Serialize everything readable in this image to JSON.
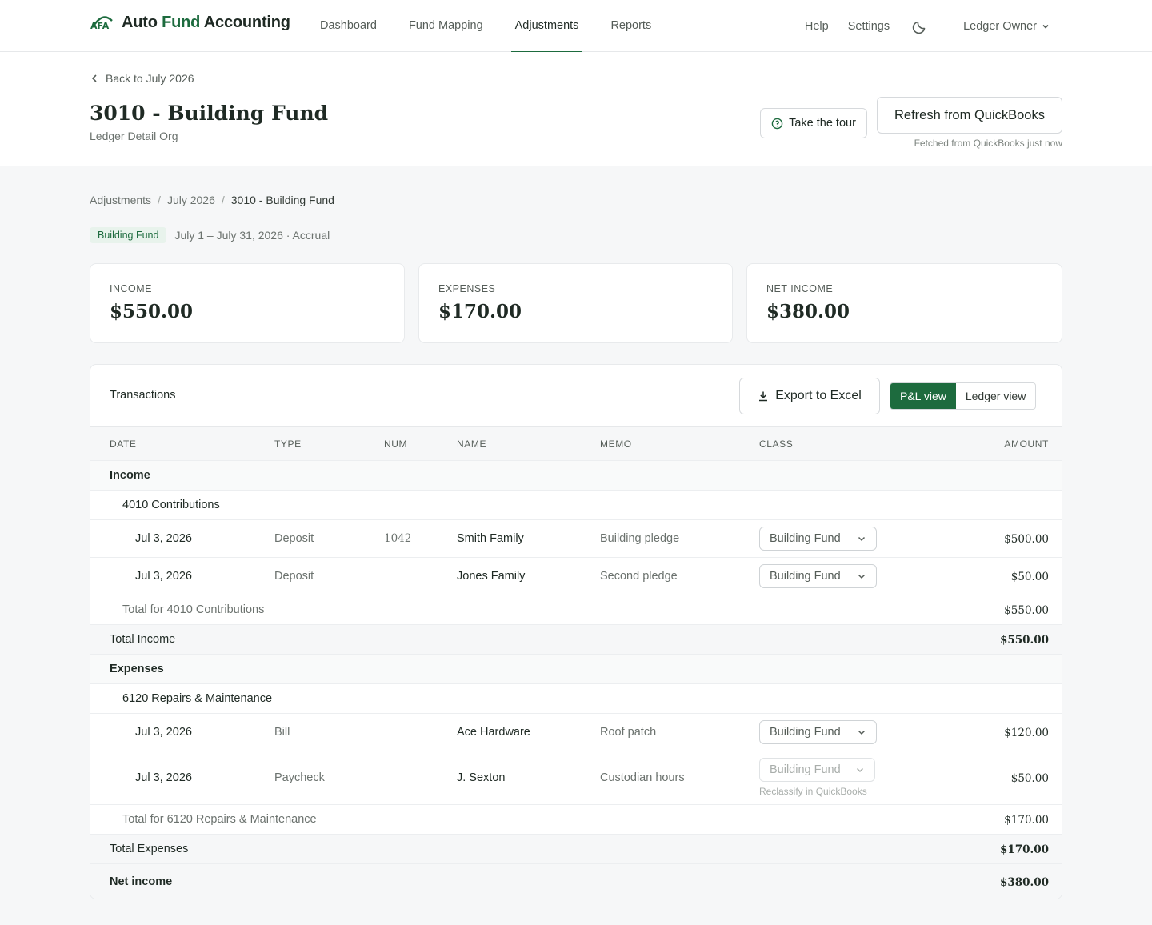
{
  "nav": {
    "brand_part1": "Auto ",
    "brand_part2": "Fund",
    "brand_part3": " Accounting",
    "logo_mark": "AFA",
    "links": [
      "Dashboard",
      "Fund Mapping",
      "Adjustments",
      "Reports"
    ],
    "active_link": "Adjustments",
    "help": "Help",
    "settings": "Settings",
    "user": "Ledger Owner"
  },
  "header": {
    "back": "Back to July 2026",
    "title": "3010 - Building Fund",
    "subtitle": "Ledger Detail Org",
    "tour": "Take the tour",
    "refresh": "Refresh from QuickBooks",
    "fetched": "Fetched from QuickBooks just now"
  },
  "breadcrumb": [
    "Adjustments",
    "July 2026",
    "3010 - Building Fund"
  ],
  "meta": {
    "badge": "Building Fund",
    "period": "July 1 – July 31, 2026 · Accrual"
  },
  "summary": [
    {
      "label": "INCOME",
      "value": "$550.00"
    },
    {
      "label": "EXPENSES",
      "value": "$170.00"
    },
    {
      "label": "NET INCOME",
      "value": "$380.00"
    }
  ],
  "transactions": {
    "title": "Transactions",
    "export": "Export to Excel",
    "view_pl": "P&L view",
    "view_ledger": "Ledger view",
    "columns": [
      "DATE",
      "TYPE",
      "NUM",
      "NAME",
      "MEMO",
      "CLASS",
      "AMOUNT"
    ],
    "income_label": "Income",
    "income_account": "4010 Contributions",
    "income_rows": [
      {
        "date": "Jul 3, 2026",
        "type": "Deposit",
        "num": "1042",
        "name": "Smith Family",
        "memo": "Building pledge",
        "class": "Building Fund",
        "amount": "$500.00"
      },
      {
        "date": "Jul 3, 2026",
        "type": "Deposit",
        "num": "",
        "name": "Jones Family",
        "memo": "Second pledge",
        "class": "Building Fund",
        "amount": "$50.00"
      }
    ],
    "income_account_total_label": "Total for 4010 Contributions",
    "income_account_total": "$550.00",
    "total_income_label": "Total Income",
    "total_income": "$550.00",
    "expense_label": "Expenses",
    "expense_account": "6120 Repairs & Maintenance",
    "expense_rows": [
      {
        "date": "Jul 3, 2026",
        "type": "Bill",
        "num": "",
        "name": "Ace Hardware",
        "memo": "Roof patch",
        "class": "Building Fund",
        "amount": "$120.00"
      },
      {
        "date": "Jul 3, 2026",
        "type": "Paycheck",
        "num": "",
        "name": "J. Sexton",
        "memo": "Custodian hours",
        "class": "Building Fund",
        "amount": "$50.00",
        "note": "Reclassify in QuickBooks"
      }
    ],
    "expense_account_total_label": "Total for 6120 Repairs & Maintenance",
    "expense_account_total": "$170.00",
    "total_expenses_label": "Total Expenses",
    "total_expenses": "$170.00",
    "net_income_label": "Net income",
    "net_income": "$380.00"
  },
  "colors": {
    "brand_green": "#1d6b3e",
    "badge_bg": "#e8f3ec"
  }
}
